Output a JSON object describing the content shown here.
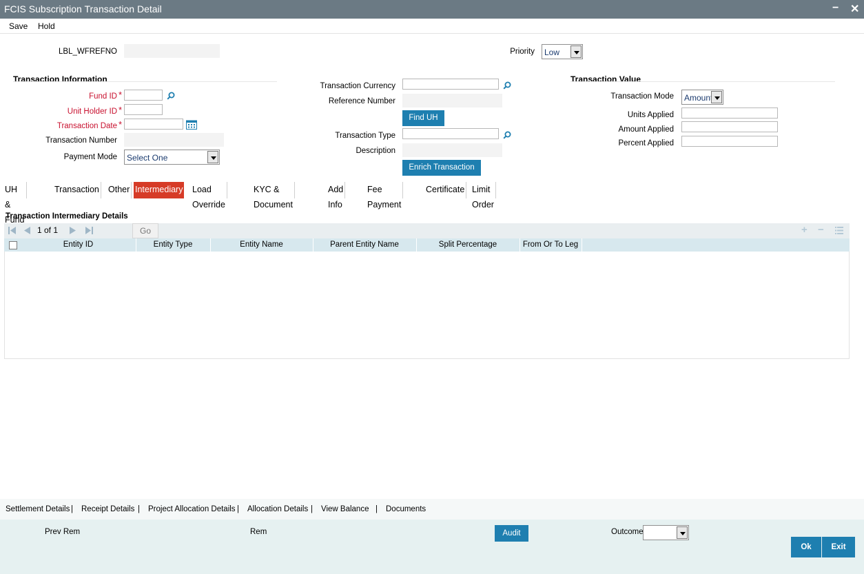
{
  "window": {
    "title": "FCIS Subscription Transaction Detail",
    "minimize": "−",
    "close": "✕"
  },
  "toolbar": {
    "save": "Save",
    "hold": "Hold"
  },
  "header": {
    "wfrefno_label": "LBL_WFREFNO",
    "priority_label": "Priority",
    "priority_value": "Low"
  },
  "transaction_info": {
    "title": "Transaction Information",
    "fund_id": "Fund ID",
    "unit_holder_id": "Unit Holder ID",
    "transaction_date": "Transaction Date",
    "transaction_number": "Transaction Number",
    "payment_mode": "Payment Mode",
    "payment_mode_value": "Select One",
    "required_mark": "*"
  },
  "middle": {
    "transaction_currency": "Transaction Currency",
    "reference_number": "Reference Number",
    "find_uh": "Find UH",
    "transaction_type": "Transaction Type",
    "description": "Description",
    "enrich_transaction": "Enrich Transaction"
  },
  "transaction_value": {
    "title": "Transaction Value",
    "transaction_mode": "Transaction Mode",
    "transaction_mode_value": "Amount",
    "units_applied": "Units Applied",
    "amount_applied": "Amount Applied",
    "percent_applied": "Percent Applied"
  },
  "tabs": [
    "UH & Fund",
    "Transaction",
    "Other",
    "Intermediary",
    "Load Override",
    "KYC & Document",
    "Add Info",
    "Fee Payment",
    "Certificate",
    "Limit Order"
  ],
  "grid": {
    "title": "Transaction Intermediary Details",
    "page_info": "1 of 1",
    "go": "Go",
    "columns": [
      "Entity ID",
      "Entity Type",
      "Entity Name",
      "Parent Entity Name",
      "Split Percentage",
      "From Or To Leg"
    ]
  },
  "links": [
    "Settlement Details",
    "Receipt Details",
    "Project Allocation Details",
    "Allocation Details",
    "View Balance",
    "Documents"
  ],
  "link_separator": "|",
  "footer": {
    "prev_rem": "Prev Rem",
    "rem": "Rem",
    "audit": "Audit",
    "outcome": "Outcome",
    "ok": "Ok",
    "exit": "Exit"
  },
  "colors": {
    "title_bar": "#6b7a84",
    "button": "#1e7fb0",
    "active_tab": "#d63b27",
    "required": "#c8102e",
    "footer": "#e6f1f1"
  }
}
